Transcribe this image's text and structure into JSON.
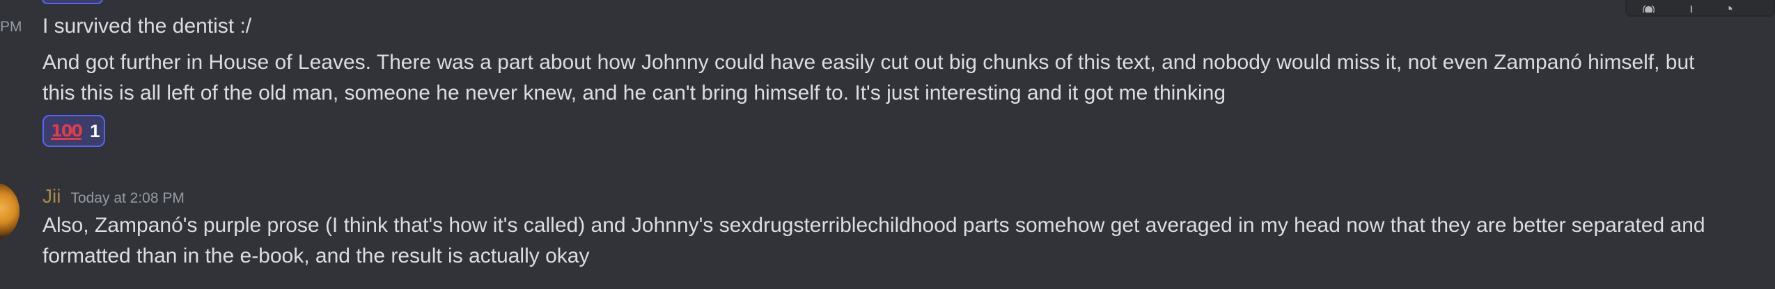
{
  "message_group_1": {
    "timestamp_fragment": "PM",
    "lines": [
      "I survived the dentist :/",
      "And got further in House of Leaves. There was a part about how Johnny could have easily cut out big chunks of this text, and nobody would miss it, not even Zampanó himself, but",
      "this this is all left of the old man, someone he never knew, and he can't bring himself to. It's just interesting and it got me thinking"
    ],
    "reaction": {
      "emoji": "100",
      "count": "1"
    }
  },
  "message_group_2": {
    "username": "Jii",
    "timestamp": "Today at 2:08 PM",
    "lines": [
      "Also, Zampanó's purple prose (I think that's how it's called) and Johnny's sexdrugsterriblechildhood parts somehow get averaged in my head now that they are better separated and",
      "formatted than in the e-book, and the result is actually okay"
    ]
  },
  "colors": {
    "background": "#313338",
    "text": "#dbdee1",
    "muted": "#949ba4",
    "username": "#a88a4a",
    "reaction_border": "#5865f2",
    "reaction_bg": "#3b3d6a",
    "emoji_red": "#e23b4b"
  },
  "icons": {
    "hover_toolbar": [
      "add-reaction-icon",
      "reply-icon",
      "more-icon"
    ],
    "avatar": "jii-avatar-image"
  }
}
